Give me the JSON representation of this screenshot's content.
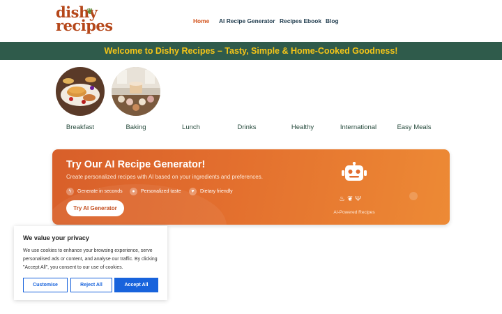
{
  "header": {
    "logo_line1": "dishy",
    "logo_line2": "recipes",
    "nav": [
      "Home",
      "AI Recipe Generator",
      "Recipes Ebook",
      "Blog"
    ]
  },
  "banner": {
    "text": "Welcome to Dishy Recipes – Tasty, Simple & Home-Cooked Goodness!"
  },
  "categories": [
    "Breakfast",
    "Baking",
    "Lunch",
    "Drinks",
    "Healthy",
    "International",
    "Easy Meals"
  ],
  "ai_card": {
    "title": "Try Our AI Recipe Generator!",
    "subtitle": "Create personalized recipes with AI based on your ingredients and preferences.",
    "features": [
      "Generate in seconds",
      "Personalized taste",
      "Dietary friendly"
    ],
    "button": "Try AI Generator",
    "powered": "AI-Powered Recipes"
  },
  "cookie": {
    "title": "We value your privacy",
    "text": "We use cookies to enhance your browsing experience, serve personalised ads or content, and analyse our traffic. By clicking \"Accept All\", you consent to our use of cookies.",
    "customise": "Customise",
    "reject": "Reject All",
    "accept": "Accept All"
  },
  "colors": {
    "brand": "#b5471a",
    "accent": "#d3541d",
    "banner_bg": "#2f5b4b",
    "banner_text": "#f5c518",
    "cookie_blue": "#1863dc"
  }
}
